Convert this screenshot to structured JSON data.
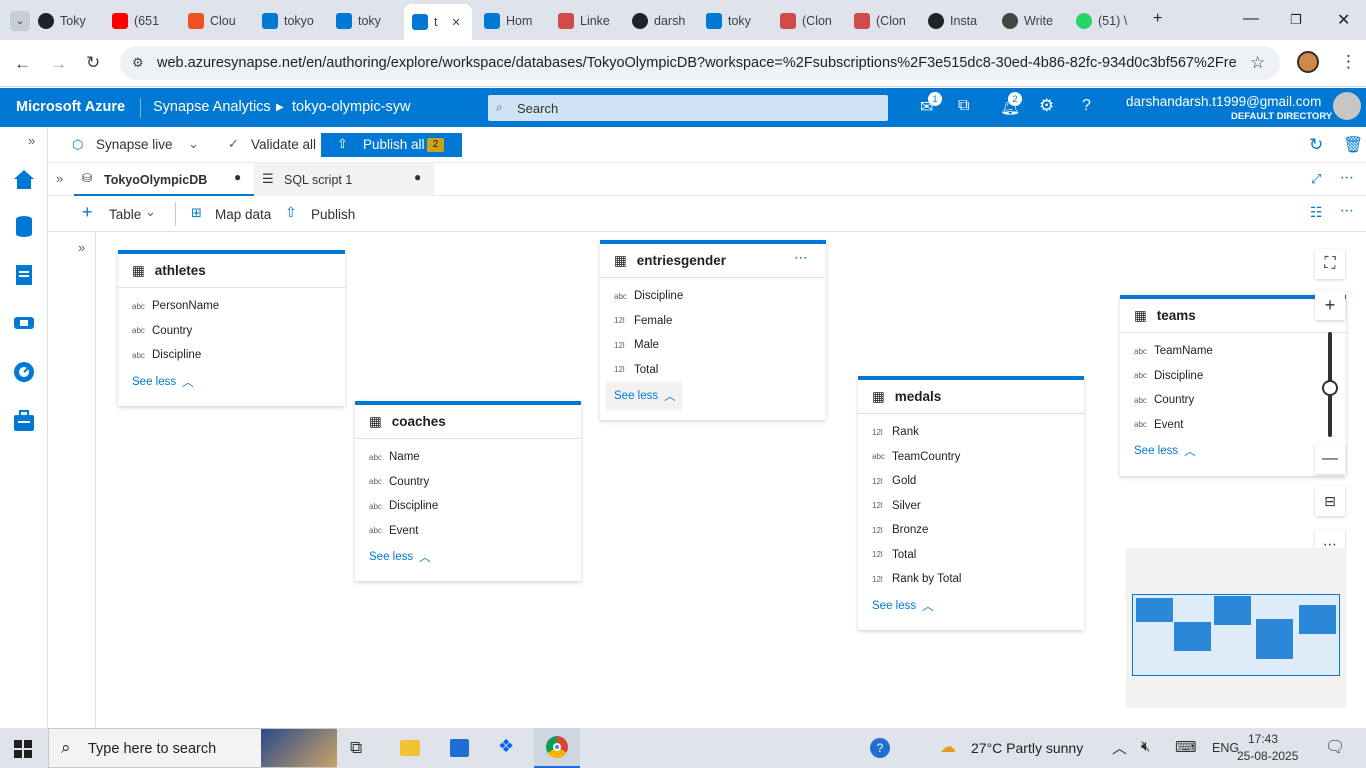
{
  "browser": {
    "tabs": [
      {
        "label": "Toky",
        "icon": "github-icon"
      },
      {
        "label": "(651",
        "icon": "youtube-icon"
      },
      {
        "label": "Clou",
        "icon": "microsoft-icon"
      },
      {
        "label": "tokyo",
        "icon": "azure-icon"
      },
      {
        "label": "toky",
        "icon": "azure-icon"
      },
      {
        "label": "t",
        "icon": "synapse-icon",
        "active": true
      },
      {
        "label": "Hom",
        "icon": "azure-icon"
      },
      {
        "label": "Linke",
        "icon": "stack-icon"
      },
      {
        "label": "darsh",
        "icon": "github-icon"
      },
      {
        "label": "toky",
        "icon": "azure-icon"
      },
      {
        "label": "(Clon",
        "icon": "stack-icon"
      },
      {
        "label": "(Clon",
        "icon": "stack-icon"
      },
      {
        "label": "Insta",
        "icon": "github-icon"
      },
      {
        "label": "Write",
        "icon": "openai-icon"
      },
      {
        "label": "(51) \\",
        "icon": "whatsapp-icon"
      }
    ],
    "url": "web.azuresynapse.net/en/authoring/explore/workspace/databases/TokyoOlympicDB?workspace=%2Fsubscriptions%2F3e515dc8-30ed-4b86-82fc-934d0c3bf567%2Fresourc..."
  },
  "azure": {
    "brand": "Microsoft Azure",
    "product": "Synapse Analytics",
    "workspace": "tokyo-olympic-syw",
    "search_placeholder": "Search",
    "feedback_badge": "1",
    "notif_badge": "2",
    "user_email": "darshandarsh.t1999@gmail.com",
    "directory": "DEFAULT DIRECTORY"
  },
  "toolbar": {
    "live_label": "Synapse live",
    "validate_label": "Validate all",
    "publish_all_label": "Publish all",
    "publish_count": "2"
  },
  "doc_tabs": [
    {
      "label": "TokyoOlympicDB"
    },
    {
      "label": "SQL script 1"
    }
  ],
  "designer": {
    "table_label": "Table",
    "map_label": "Map data",
    "publish_label": "Publish"
  },
  "tables": {
    "athletes": {
      "name": "athletes",
      "cols": [
        [
          "abc",
          "PersonName"
        ],
        [
          "abc",
          "Country"
        ],
        [
          "abc",
          "Discipline"
        ]
      ]
    },
    "coaches": {
      "name": "coaches",
      "cols": [
        [
          "abc",
          "Name"
        ],
        [
          "abc",
          "Country"
        ],
        [
          "abc",
          "Discipline"
        ],
        [
          "abc",
          "Event"
        ]
      ]
    },
    "entriesgender": {
      "name": "entriesgender",
      "cols": [
        [
          "abc",
          "Discipline"
        ],
        [
          "12l",
          "Female"
        ],
        [
          "12l",
          "Male"
        ],
        [
          "12l",
          "Total"
        ]
      ]
    },
    "medals": {
      "name": "medals",
      "cols": [
        [
          "12l",
          "Rank"
        ],
        [
          "abc",
          "TeamCountry"
        ],
        [
          "12l",
          "Gold"
        ],
        [
          "12l",
          "Silver"
        ],
        [
          "12l",
          "Bronze"
        ],
        [
          "12l",
          "Total"
        ],
        [
          "12l",
          "Rank by Total"
        ]
      ]
    },
    "teams": {
      "name": "teams",
      "cols": [
        [
          "abc",
          "TeamName"
        ],
        [
          "abc",
          "Discipline"
        ],
        [
          "abc",
          "Country"
        ],
        [
          "abc",
          "Event"
        ]
      ]
    }
  },
  "see_less": "See less",
  "taskbar": {
    "search_placeholder": "Type here to search",
    "weather": "27°C  Partly sunny",
    "lang": "ENG",
    "time": "17:43",
    "date": "25-08-2025"
  }
}
